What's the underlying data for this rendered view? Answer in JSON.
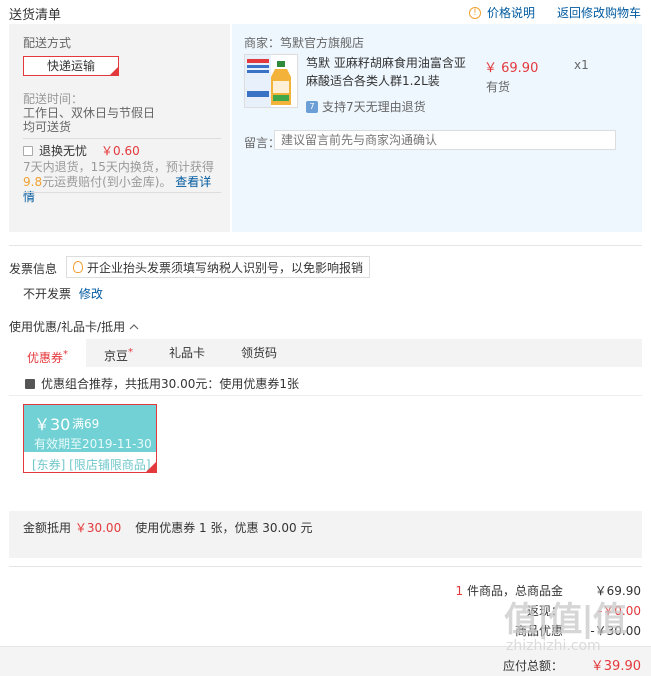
{
  "header": {
    "title": "送货清单",
    "price_note": "价格说明",
    "back_to_cart": "返回修改购物车"
  },
  "delivery": {
    "method_label": "配送方式",
    "method_value": "快递运输",
    "time_label": "配送时间：",
    "time_value_line1": "工作日、双休日与节假日",
    "time_value_line2": "均可送货",
    "return_label": "退换无忧",
    "return_price": "￥0.60",
    "return_note_line1": "7天内退货，15天内换货，预计获得",
    "return_note_amount": "9.8",
    "return_note_line2": "元运费赔付(到小金库)。",
    "return_detail_link": "查看详情"
  },
  "product": {
    "merchant": "商家：笃默官方旗舰店",
    "image_icon": "product-bottle-image",
    "name": "笃默 亚麻籽胡麻食用油富含亚麻酸适合各类人群1.2L装",
    "price": "￥ 69.90",
    "stock": "有货",
    "quantity": "x1",
    "support": "支持7天无理由退货",
    "message_label": "留言：",
    "message_placeholder": "建议留言前先与商家沟通确认"
  },
  "invoice": {
    "title": "发票信息",
    "tip": "开企业抬头发票须填写纳税人识别号，以免影响报销",
    "value": "不开发票",
    "modify": "修改"
  },
  "coupon": {
    "title": "使用优惠/礼品卡/抵用",
    "tabs": [
      {
        "label": "优惠券",
        "mark": "*"
      },
      {
        "label": "京豆",
        "mark": "*"
      },
      {
        "label": "礼品卡",
        "mark": ""
      },
      {
        "label": "领货码",
        "mark": ""
      }
    ],
    "combo_text": "优惠组合推荐，共抵用30.00元：使用优惠券1张",
    "card": {
      "amount": "￥30",
      "condition": "满69",
      "expiry": "有效期至2019-11-30",
      "scope": "[东券] [限店铺限商品]"
    },
    "deduct_label": "金额抵用",
    "deduct_value": "￥30.00",
    "used_note": "使用优惠券 1 张，优惠 30.00 元"
  },
  "totals": {
    "item_count": "1",
    "item_text": "件商品，总商品金",
    "goods_total": "￥69.90",
    "row2_label": "返现：",
    "row2_value": "-￥0.00",
    "row3_label": "商品优惠",
    "row3_value": "-￥30.00",
    "pay_label": "应付总额：",
    "pay_value": "￥39.90"
  },
  "watermark": {
    "logo": "值|值|值",
    "site": "zhizhizhi.com"
  },
  "colors": {
    "accent_red": "#e4393c",
    "link_blue": "#005aa0",
    "coupon_teal": "#71d1d4"
  }
}
